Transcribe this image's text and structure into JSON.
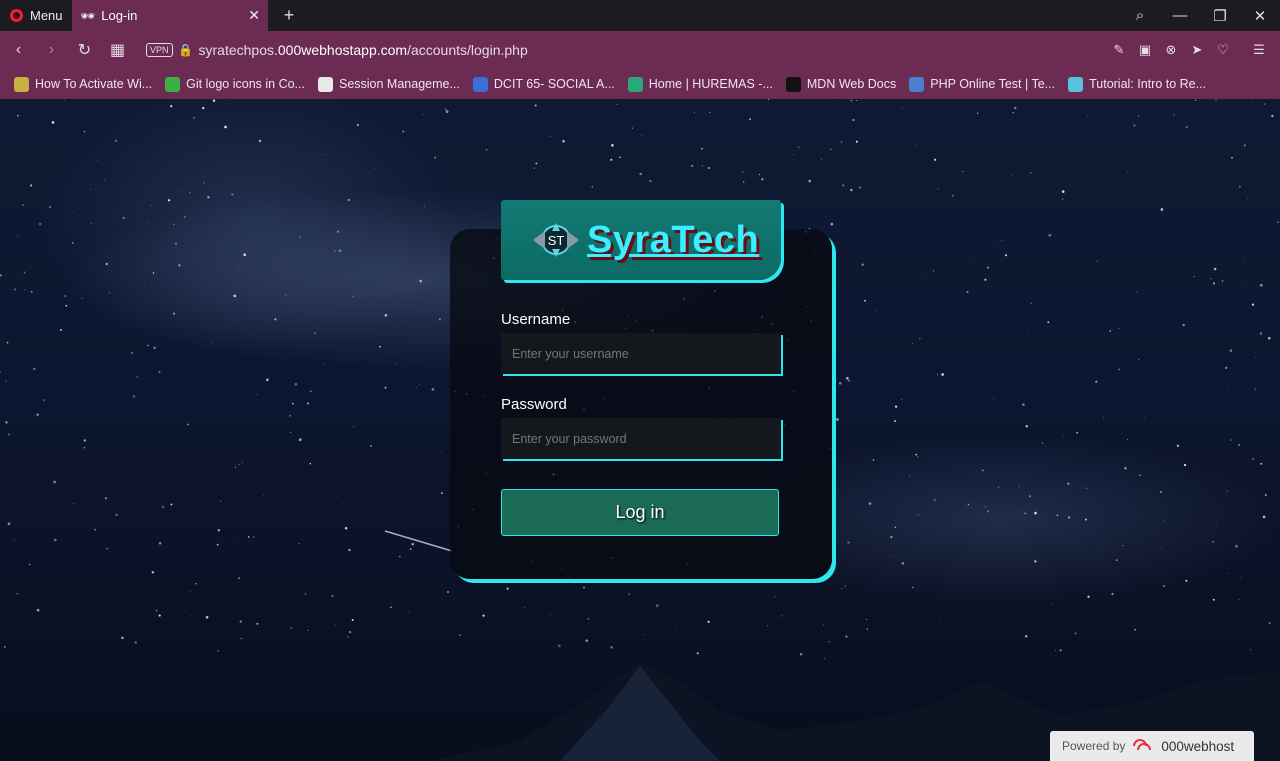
{
  "browser": {
    "menu_label": "Menu",
    "tab_title": "Log-in",
    "url_prefix": "syratechpos.",
    "url_host": "000webhostapp.com",
    "url_path": "/accounts/login.php",
    "vpn_label": "VPN"
  },
  "bookmarks": [
    {
      "label": "How To Activate Wi...",
      "color": "#c8b040"
    },
    {
      "label": "Git logo icons in Co...",
      "color": "#3cb043"
    },
    {
      "label": "Session Manageme...",
      "color": "#e8e8e8"
    },
    {
      "label": "DCIT 65- SOCIAL A...",
      "color": "#3a6fd8"
    },
    {
      "label": "Home | HUREMAS -...",
      "color": "#2aa876"
    },
    {
      "label": "MDN Web Docs",
      "color": "#111111"
    },
    {
      "label": "PHP Online Test | Te...",
      "color": "#4a7fd0"
    },
    {
      "label": "Tutorial: Intro to Re...",
      "color": "#58c4dc"
    }
  ],
  "login": {
    "brand": "SyraTech",
    "username_label": "Username",
    "username_placeholder": "Enter your username",
    "password_label": "Password",
    "password_placeholder": "Enter your password",
    "submit_label": "Log in"
  },
  "footer": {
    "powered_by": "Powered by",
    "host_name": "000webhost"
  },
  "colors": {
    "accent": "#2ee6ee",
    "chrome": "#6b2b52",
    "button": "#1a6a56",
    "brand_box": "#0c6a66"
  }
}
